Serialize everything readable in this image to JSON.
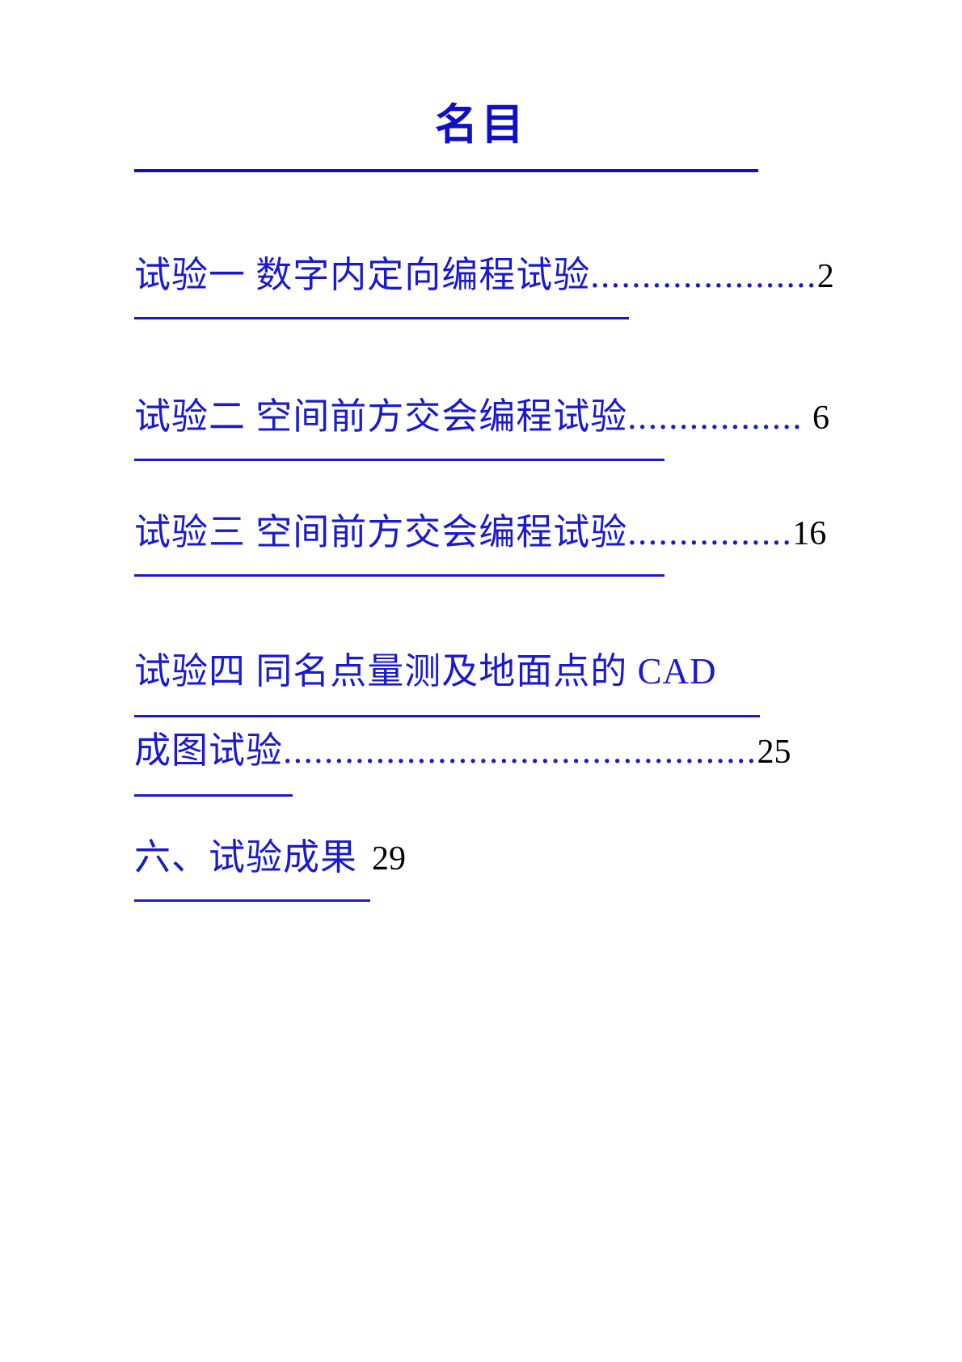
{
  "document": {
    "title": "名目",
    "accent_color": "#1a1ad0",
    "title_color": "#0f0fc8",
    "page_number_color": "#000000",
    "background_color": "#ffffff"
  },
  "toc": {
    "entries": [
      {
        "id": "entry-1",
        "label": "试验一  数字内定向编程试验",
        "leader": "......................",
        "page": "2"
      },
      {
        "id": "entry-2",
        "label": "试验二  空间前方交会编程试验",
        "leader": ".................",
        "page": "6"
      },
      {
        "id": "entry-3",
        "label": "试验三  空间前方交会编程试验",
        "leader": "................",
        "page": "16"
      },
      {
        "id": "entry-4",
        "label_line1": "试验四  同名点量测及地面点的  CAD",
        "label_line2": "成图试验",
        "leader": "..............................................",
        "page": "25"
      },
      {
        "id": "entry-5",
        "label": "六、试验成果",
        "leader": "",
        "page": "29"
      }
    ]
  }
}
